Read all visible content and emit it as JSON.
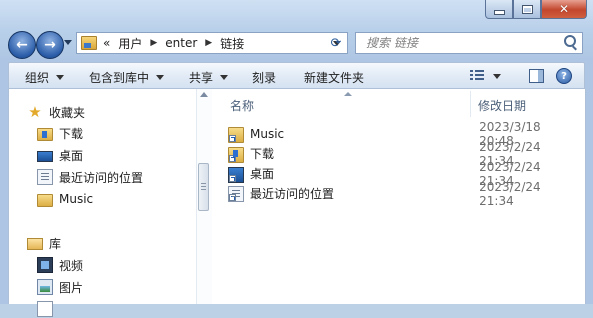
{
  "window": {
    "caption_min": "–",
    "caption_max": "□",
    "caption_close": "✕"
  },
  "address": {
    "overflow": "«",
    "crumbs": [
      "用户",
      "enter",
      "链接"
    ]
  },
  "search": {
    "placeholder": "搜索 链接"
  },
  "toolbar": {
    "organize": "组织",
    "include_in_library": "包含到库中",
    "share": "共享",
    "burn": "刻录",
    "new_folder": "新建文件夹",
    "help": "?"
  },
  "nav": {
    "favorites": "收藏夹",
    "items": [
      "下载",
      "桌面",
      "最近访问的位置",
      "Music"
    ],
    "libraries": "库",
    "library_items": [
      "视频",
      "图片",
      ""
    ]
  },
  "files": {
    "columns": {
      "name": "名称",
      "modified": "修改日期"
    },
    "rows": [
      {
        "name": "Music",
        "date": "2023/3/18 20:48"
      },
      {
        "name": "下载",
        "date": "2023/2/24 21:34"
      },
      {
        "name": "桌面",
        "date": "2023/2/24 21:34"
      },
      {
        "name": "最近访问的位置",
        "date": "2023/2/24 21:34"
      }
    ]
  }
}
